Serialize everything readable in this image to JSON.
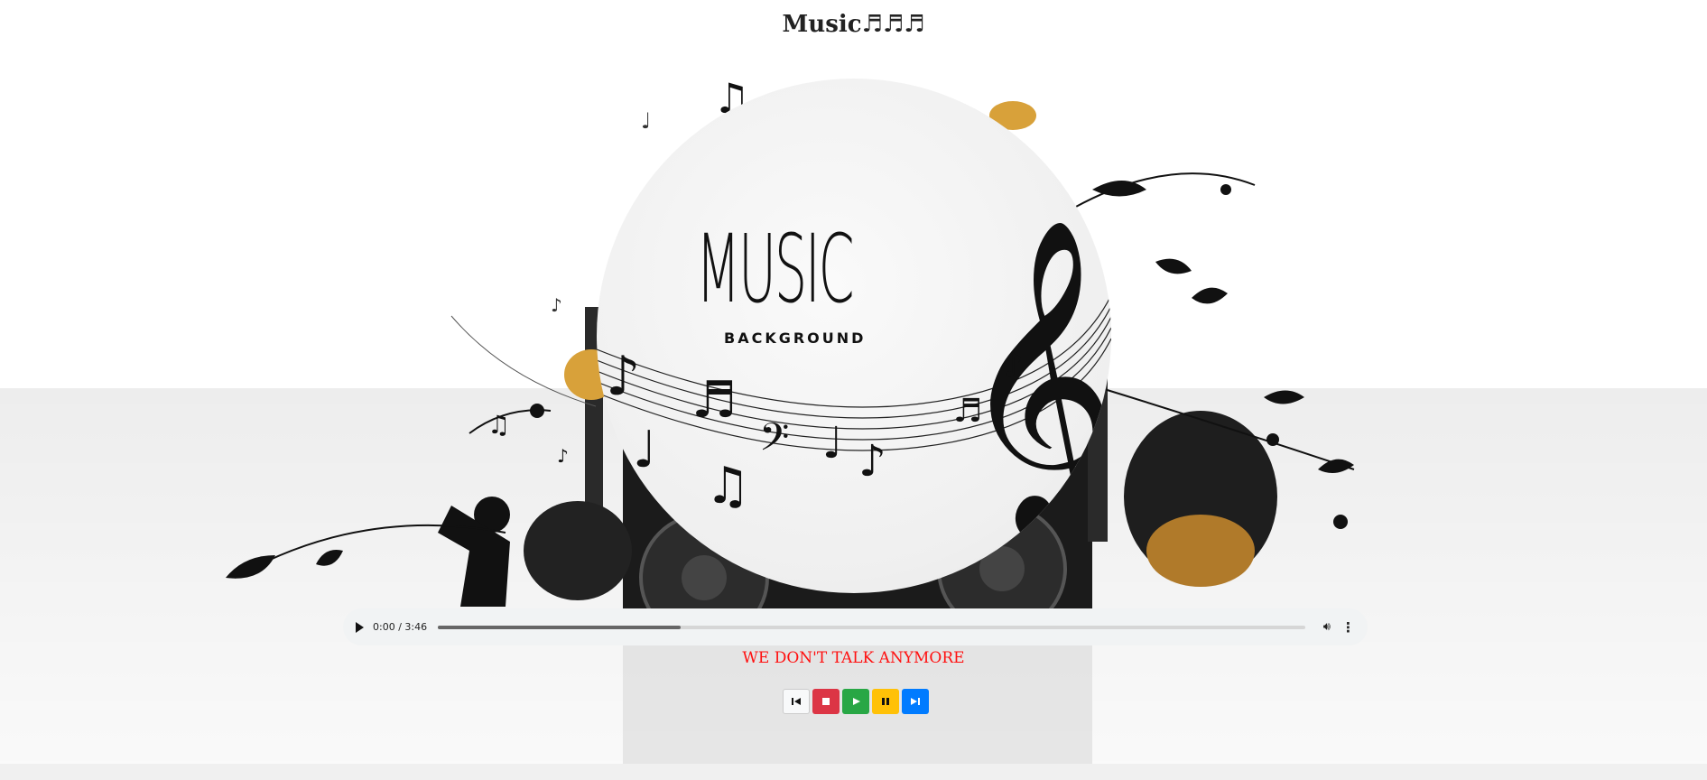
{
  "page": {
    "title": "Music♬♬♬"
  },
  "artwork": {
    "headline": "MUSIC",
    "subheadline": "BACKGROUND"
  },
  "player": {
    "time": "0:00 / 3:46",
    "progress": 0.28,
    "play_icon": "play-icon",
    "volume_icon": "volume-icon",
    "more_icon": "more-options-icon"
  },
  "song": {
    "title": "WE DON'T TALK ANYMORE"
  },
  "controls": {
    "prev_icon": "skip-previous-icon",
    "stop_icon": "stop-icon",
    "play_icon": "play-icon",
    "pause_icon": "pause-icon",
    "next_icon": "skip-next-icon"
  },
  "colors": {
    "song_title": "#ff1010",
    "stop": "#dc3545",
    "play": "#28a745",
    "pause": "#ffc107",
    "next": "#007bff"
  }
}
